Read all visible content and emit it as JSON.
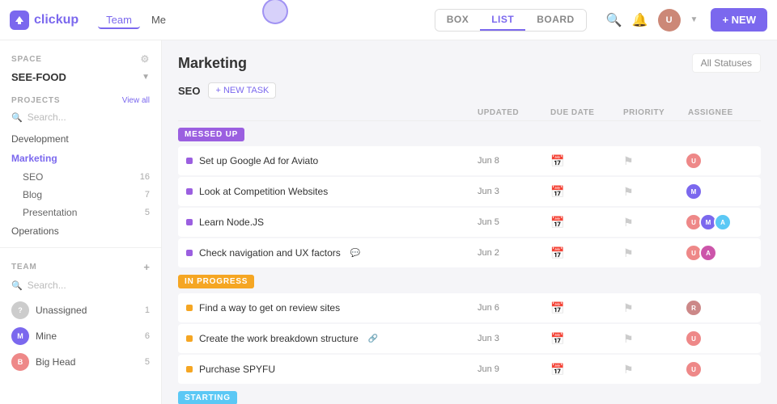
{
  "logo": {
    "text": "clickup"
  },
  "topnav": {
    "links": [
      {
        "label": "Team",
        "active": true
      },
      {
        "label": "Me",
        "active": false
      }
    ],
    "views": [
      {
        "label": "BOX",
        "active": false
      },
      {
        "label": "LIST",
        "active": true
      },
      {
        "label": "BOARD",
        "active": false
      }
    ],
    "new_button": "+ NEW"
  },
  "sidebar": {
    "space_label": "SPACE",
    "space_name": "SEE-FOOD",
    "projects_label": "PROJECTS",
    "projects_plus": "+",
    "view_all": "View all",
    "search_placeholder": "Search...",
    "nav_items": [
      {
        "label": "Development",
        "badge": ""
      },
      {
        "label": "Marketing",
        "active": true,
        "badge": ""
      }
    ],
    "sub_items": [
      {
        "label": "SEO",
        "badge": "16"
      },
      {
        "label": "Blog",
        "badge": "7"
      },
      {
        "label": "Presentation",
        "badge": "5"
      }
    ],
    "operations": "Operations",
    "team_label": "TEAM",
    "team_plus": "+",
    "team_search": "Search...",
    "members": [
      {
        "label": "Unassigned",
        "badge": "1",
        "color": "#ccc"
      },
      {
        "label": "Mine",
        "badge": "6",
        "color": "#7b68ee"
      },
      {
        "label": "Big Head",
        "badge": "5",
        "color": "#e88"
      }
    ]
  },
  "content": {
    "title": "Marketing",
    "status_filter": "All Statuses",
    "seo_section": "SEO",
    "new_task_btn": "+ NEW TASK",
    "columns": {
      "updated": "UPDATED",
      "due_date": "DUE DATE",
      "priority": "PRIORITY",
      "assignee": "ASSIGNEE"
    },
    "sections": [
      {
        "name": "MESSED UP",
        "type": "messed-up",
        "tasks": [
          {
            "name": "Set up Google Ad for Aviato",
            "updated": "Jun 8",
            "dot": "purple",
            "assignees": 1,
            "colors": [
              "#e88"
            ]
          },
          {
            "name": "Look at Competition Websites",
            "updated": "Jun 3",
            "dot": "purple",
            "assignees": 1,
            "colors": [
              "#7b68ee"
            ]
          },
          {
            "name": "Learn Node.JS",
            "updated": "Jun 5",
            "dot": "purple",
            "assignees": 3,
            "colors": [
              "#e88",
              "#7b68ee",
              "#5bc8f5"
            ]
          },
          {
            "name": "Check navigation and UX factors",
            "updated": "Jun 2",
            "dot": "purple",
            "has_icon": true,
            "assignees": 2,
            "colors": [
              "#e88",
              "#c5a"
            ]
          }
        ]
      },
      {
        "name": "IN PROGRESS",
        "type": "in-progress",
        "tasks": [
          {
            "name": "Find a way to get on review sites",
            "updated": "Jun 6",
            "dot": "yellow",
            "assignees": 1,
            "colors": [
              "#c88"
            ]
          },
          {
            "name": "Create the work breakdown structure",
            "updated": "Jun 3",
            "dot": "yellow",
            "has_icon": true,
            "assignees": 1,
            "colors": [
              "#e88"
            ]
          },
          {
            "name": "Purchase SPYFU",
            "updated": "Jun 9",
            "dot": "yellow",
            "assignees": 1,
            "colors": [
              "#e88"
            ]
          }
        ]
      },
      {
        "name": "STARTING",
        "type": "starting",
        "tasks": []
      }
    ]
  }
}
